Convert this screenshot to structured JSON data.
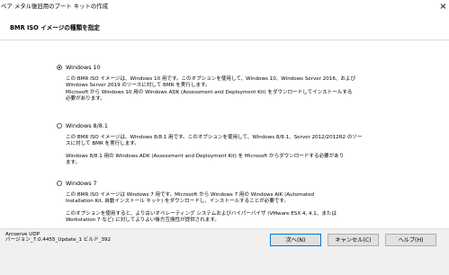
{
  "window": {
    "title": "ベア メタル復旧用のブート キットの作成",
    "close_glyph": "×"
  },
  "header": {
    "title": "BMR ISO イメージの種類を指定"
  },
  "options": [
    {
      "label": "Windows 10",
      "selected": true,
      "paragraphs": [
        "この BMR ISO イメージは、Windows 10 用です。このオプションを使用して、Windows 10、Windows Server 2016、および\nWindows Server 2019 のソースに対して BMR を実行します。\nMicrosoft から Windows 10 用の Windows ADK (Assessment and Deployment Kit) をダウンロードしてインストールする\n必要があります。"
      ]
    },
    {
      "label": "Windows 8/8.1",
      "selected": false,
      "paragraphs": [
        "この BMR ISO イメージは、Windows 8/8.1 用です。このオプションを使用して、Windows 8/8.1、Server 2012/2012R2 のソー\nスに対して BMR を実行します。",
        "Windows 8/8.1 用の Windows ADK (Assessment and Deployment Kit) を Microsoft からダウンロードする必要があり\nます。"
      ]
    },
    {
      "label": "Windows 7",
      "selected": false,
      "paragraphs": [
        "この BMR ISO イメージは Windows 7 用です。Microsoft から Windows 7 用の Windows AIK (Automated\nInstallation Kit, 自動インストール キット) をダウンロードし、インストールすることが必要です。",
        "このオプションを使用すると、より古いオペレーティング システムおよびハイパーバイザ (VMware ESX 4, 4.1、または\nWorkstation 7 など) に対してよりよい後方互換性が提供されます。"
      ]
    }
  ],
  "footer": {
    "product_name": "Arcserve UDP",
    "version": "バージョン_7.0.4455_Update_1 ビルド_392",
    "buttons": {
      "next": "次へ(N)",
      "cancel": "キャンセル(C)",
      "help": "ヘルプ(H)"
    }
  }
}
